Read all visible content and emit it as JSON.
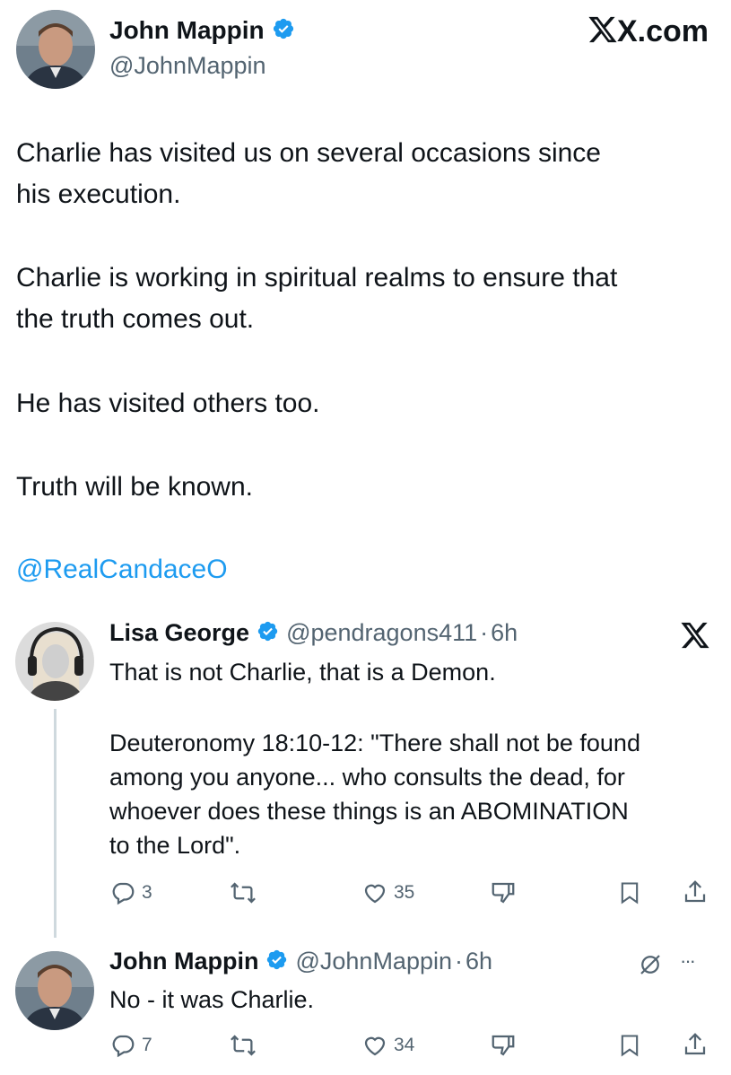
{
  "main_tweet": {
    "author_name": "John Mappin",
    "author_handle": "@JohnMappin",
    "site_label": "X.com",
    "text_lines": [
      "Charlie has visited us on several occasions since",
      "his execution.",
      "Charlie is working in spiritual realms to ensure that",
      "the truth comes out.",
      "He has visited others too.",
      "Truth will be known."
    ],
    "mention": "@RealCandaceO"
  },
  "reply_1": {
    "author_name": "Lisa George",
    "author_handle": "@pendragons411",
    "separator": "·",
    "time": "6h",
    "text_lines": [
      "That is not Charlie, that is a Demon.",
      "Deuteronomy 18:10-12: \"There shall not be found",
      "among you anyone... who consults the dead, for",
      "whoever does these things is an ABOMINATION",
      "to the Lord\"."
    ],
    "replies": "3",
    "likes": "35"
  },
  "reply_2": {
    "author_name": "John Mappin",
    "author_handle": "@JohnMappin",
    "separator": "·",
    "time": "6h",
    "text": "No - it was Charlie.",
    "replies": "7",
    "likes": "34",
    "more": "···"
  },
  "colors": {
    "verified": "#1d9bf0",
    "mention": "#1d9bf0",
    "text": "#0f1419",
    "muted": "#536471",
    "thread_line": "#cfd9de"
  }
}
